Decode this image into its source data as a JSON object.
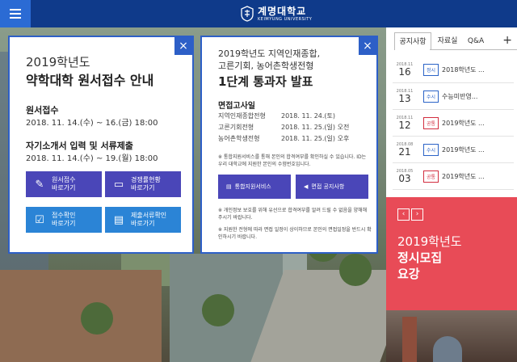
{
  "header": {
    "logo_kr": "계명대학교",
    "logo_en": "KEIMYUNG UNIVERSITY"
  },
  "popup1": {
    "title_line1": "2019학년도",
    "title_line2": "약학대학 원서접수 안내",
    "section1_label": "원서접수",
    "section1_dates": "2018. 11. 14.(수) ~ 16.(금) 18:00",
    "section2_label": "자기소개서 입력 및 서류제출",
    "section2_dates": "2018. 11. 14.(수) ~ 19.(월) 18:00",
    "buttons": [
      {
        "label1": "원서접수",
        "label2": "바로가기"
      },
      {
        "label1": "경쟁률현황",
        "label2": "바로가기"
      },
      {
        "label1": "접수확인",
        "label2": "바로가기"
      },
      {
        "label1": "제출서류확인",
        "label2": "바로가기"
      }
    ]
  },
  "popup2": {
    "line1": "2019학년도 지역인재종합,",
    "line2": "고른기회, 농어촌학생전형",
    "headline": "1단계 통과자 발표",
    "sub": "면접고사일",
    "rows": [
      {
        "name": "지역인재종합전형",
        "date": "2018. 11. 24.(토)"
      },
      {
        "name": "고른기회전형",
        "date": "2018. 11. 25.(일) 오전"
      },
      {
        "name": "농어촌학생전형",
        "date": "2018. 11. 25.(일) 오후"
      }
    ],
    "note1": "※ 통합지원서비스를 통해 본인의 합격여부를 확인하실 수 있습니다. ID는 우리 대학교에 지원한 본인의 수험번호입니다.",
    "button1": "통합지원서비스",
    "button2": "면접 공지사항",
    "note2": "※ 개인정보 보호를 위해 유선으로 합격여부를 알려 드릴 수 없음을 양해해 주시기 바랍니다.",
    "note3": "※ 지원한 전형에 따라 면접 일정이 상이하므로 본인의 면접일정을 반드시 확인하시기 바랍니다."
  },
  "close_symbol": "×",
  "side": {
    "tabs": [
      "공지사항",
      "자료실",
      "Q&A"
    ],
    "plus": "+",
    "news": [
      {
        "ym": "2018.11",
        "dd": "16",
        "badge": "정시",
        "color": "blue",
        "title": "2018학년도 ..."
      },
      {
        "ym": "2018.11",
        "dd": "13",
        "badge": "수시",
        "color": "blue",
        "title": "수능미반영..."
      },
      {
        "ym": "2018.11",
        "dd": "12",
        "badge": "공통",
        "color": "red",
        "title": "2019학년도 ..."
      },
      {
        "ym": "2018.08",
        "dd": "21",
        "badge": "수시",
        "color": "blue",
        "title": "2019학년도 ..."
      },
      {
        "ym": "2018.05",
        "dd": "03",
        "badge": "공통",
        "color": "red",
        "title": "2019학년도 ..."
      }
    ],
    "promo": {
      "prev": "‹",
      "next": "›",
      "line1": "2019학년도",
      "line2": "정시모집",
      "line3": "요강"
    }
  },
  "colors": {
    "header_bg": "#0f3a8a",
    "popup_border": "#2d5fc7",
    "promo_bg": "#e84b57"
  }
}
